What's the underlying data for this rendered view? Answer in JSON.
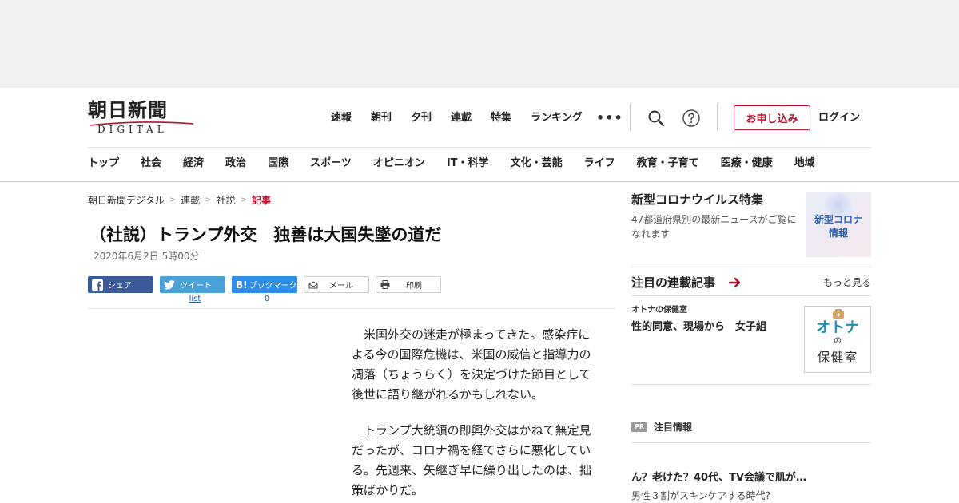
{
  "site": {
    "logo_main": "朝日新聞",
    "logo_sub": "DIGITAL"
  },
  "header": {
    "nav": [
      "速報",
      "朝刊",
      "夕刊",
      "連載",
      "特集",
      "ランキング"
    ],
    "more": "•••",
    "subscribe": "お申し込み",
    "login": "ログイン"
  },
  "categories": [
    "トップ",
    "社会",
    "経済",
    "政治",
    "国際",
    "スポーツ",
    "オピニオン",
    "IT・科学",
    "文化・芸能",
    "ライフ",
    "教育・子育て",
    "医療・健康",
    "地域"
  ],
  "breadcrumb": [
    "朝日新聞デジタル",
    "連載",
    "社説",
    "記事"
  ],
  "article": {
    "title": "（社説）トランプ外交　独善は大国失墜の道だ",
    "date": "2020年6月2日 5時00分",
    "p1": "　米国外交の迷走が極まってきた。感染症による今の国際危機は、米国の威信と指導力の凋落（ちょうらく）を決定づけた節目として後世に語り継がれるかもしれない。",
    "p2_indent": "　",
    "p2_keyword": "トランプ大統領",
    "p2_rest": "の即興外交はかねて無定見だったが、コロナ禍を経てさらに悪化している。先週来、矢継ぎ早に繰り出したのは、拙策ばかりだ。"
  },
  "share": {
    "facebook": "シェア",
    "twitter": "ツイート",
    "twitter_count": "list",
    "hatena": "ブックマーク",
    "hatena_count": "0",
    "mail": "メール",
    "print": "印刷"
  },
  "sidebar": {
    "feature_title": "新型コロナウイルス特集",
    "feature_desc": "47都道府県別の最新ニュースがご覧になれます",
    "feature_img_label_1": "新型コロナ",
    "feature_img_label_2": "情報",
    "serial_title": "注目の連載記事",
    "serial_more": "もっと見る",
    "serial_category": "オトナの保健室",
    "serial_headline": "性的同意、現場から　女子組",
    "otona_1": "オトナ",
    "otona_2": "の",
    "otona_3": "保健室",
    "pr_badge": "PR",
    "pr_title": "注目情報",
    "pr_headline": "ん？老けた？40代、TV会議で肌が…",
    "pr_sub": "男性３割がスキンケアする時代？"
  },
  "colors": {
    "accent": "#b0122c",
    "facebook": "#3b5998",
    "twitter": "#4aa1d8",
    "hatena": "#2c8ee6"
  }
}
